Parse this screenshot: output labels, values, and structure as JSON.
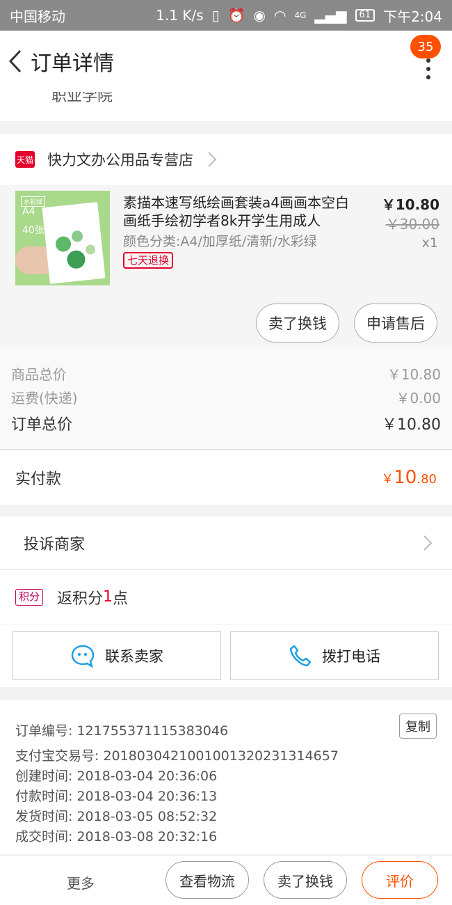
{
  "status_bar": {
    "carrier": "中国移动",
    "speed": "1.1 K/s",
    "network": "4G",
    "battery": "61",
    "time": "下午2:04"
  },
  "header": {
    "title": "订单详情",
    "badge_count": "35"
  },
  "address": {
    "tail_text": "职业学院"
  },
  "shop": {
    "platform_label": "天猫",
    "name": "快力文办公用品专营店"
  },
  "product": {
    "image_tag": "水彩绿",
    "image_size": "A4",
    "image_pages": "40张",
    "title": "素描本速写纸绘画套装a4画画本空白画纸手绘初学者8k开学生用成人",
    "spec": "颜色分类:A4/加厚纸/清新/水彩绿",
    "return_badge": "七天退换",
    "price": "￥10.80",
    "original_price": "￥30.00",
    "quantity": "x1",
    "actions": [
      "卖了换钱",
      "申请售后"
    ]
  },
  "summary": {
    "goods_total_label": "商品总价",
    "goods_total": "￥10.80",
    "shipping_label": "运费(快递)",
    "shipping": "￥0.00",
    "order_total_label": "订单总价",
    "order_total": "￥10.80",
    "paid_label": "实付款",
    "paid_currency": "￥",
    "paid_int": "10",
    "paid_dec": ".80"
  },
  "complaint": {
    "label": "投诉商家"
  },
  "points": {
    "tag": "积分",
    "prefix": "返积分",
    "count": "1",
    "suffix": "点"
  },
  "contact": {
    "seller_label": "联系卖家",
    "phone_label": "拨打电话"
  },
  "order_info": {
    "order_no": "订单编号: 121755371115383046",
    "copy_label": "复制",
    "alipay_no": "支付宝交易号: 2018030421001001320231314657",
    "created": "创建时间: 2018-03-04 20:36:06",
    "paid": "付款时间: 2018-03-04 20:36:13",
    "shipped": "发货时间: 2018-03-05 08:52:32",
    "completed": "成交时间: 2018-03-08 20:32:16"
  },
  "bottom_bar": {
    "more": "更多",
    "logistics": "查看物流",
    "resell": "卖了换钱",
    "review": "评价"
  },
  "colors": {
    "accent": "#ff5000",
    "tmall_red": "#e4002b",
    "contact_blue": "#1e9fe0"
  }
}
